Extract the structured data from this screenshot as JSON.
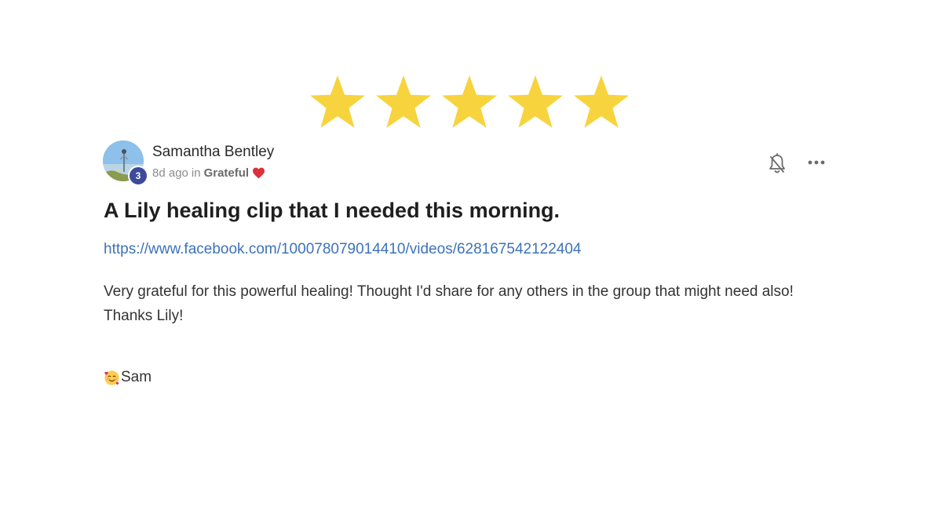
{
  "rating": {
    "stars": 5,
    "max": 5,
    "color": "#f7d43e"
  },
  "author": {
    "name": "Samantha Bentley",
    "level": "3",
    "avatar": "avatar-photo"
  },
  "meta": {
    "time": "8d ago",
    "in_text": "in",
    "category": "Grateful",
    "category_icon": "heart-icon",
    "heart_color": "#d9323a"
  },
  "actions": {
    "bell_icon": "bell-off-icon",
    "more_icon": "more-horizontal-icon"
  },
  "post": {
    "title": "A Lily healing clip that I needed this morning.",
    "link": "https://www.facebook.com/100078079014410/videos/628167542122404",
    "link_color": "#3d72b8",
    "body_line1": "Very grateful for this powerful healing! Thought I'd share for any others in the group that might need also!",
    "body_line2": "Thanks Lily!",
    "signoff_emoji": "smiling-face-with-hearts-icon",
    "signoff_name": "Sam"
  }
}
